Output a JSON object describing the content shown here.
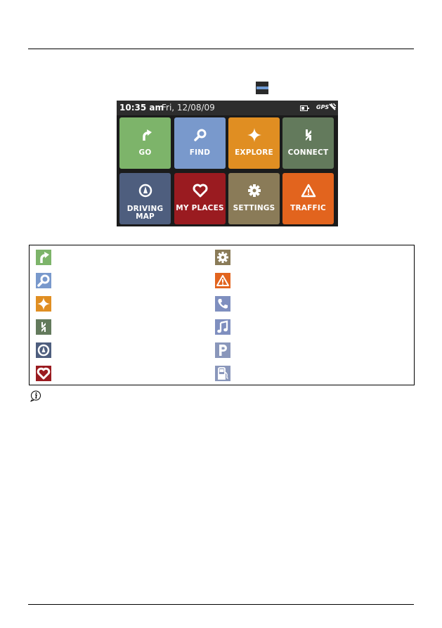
{
  "page": {
    "menu_button_icon": "menu-icon"
  },
  "device": {
    "status_bar": {
      "time": "10:35 am",
      "date": "Fri, 12/08/09",
      "gps_label": "GPS",
      "battery_icon": "battery-icon",
      "signal_icon": "gps-signal-icon"
    },
    "tiles": [
      {
        "label": "GO",
        "icon": "turn-arrow-icon",
        "color": "#7db46a"
      },
      {
        "label": "FIND",
        "icon": "magnifier-icon",
        "color": "#7999cc"
      },
      {
        "label": "EXPLORE",
        "icon": "sparkle-icon",
        "color": "#e08e22"
      },
      {
        "label": "CONNECT",
        "icon": "connect-icon",
        "color": "#637a5c"
      },
      {
        "label_line1": "DRIVING",
        "label_line2": "MAP",
        "icon": "compass-icon",
        "color": "#4e5e7e"
      },
      {
        "label": "MY PLACES",
        "icon": "heart-icon",
        "color": "#9a1b20"
      },
      {
        "label": "SETTINGS",
        "icon": "gear-icon",
        "color": "#8a7b58"
      },
      {
        "label": "TRAFFIC",
        "icon": "warning-icon",
        "color": "#e2641e"
      }
    ]
  },
  "legend": {
    "left_column": [
      {
        "icon": "turn-arrow-icon",
        "color": "#7db46a"
      },
      {
        "icon": "magnifier-icon",
        "color": "#7999cc"
      },
      {
        "icon": "sparkle-icon",
        "color": "#e08e22"
      },
      {
        "icon": "connect-icon",
        "color": "#637a5c"
      },
      {
        "icon": "compass-icon",
        "color": "#4e5e7e"
      },
      {
        "icon": "heart-icon",
        "color": "#9a1b20"
      }
    ],
    "right_column": [
      {
        "icon": "gear-icon",
        "color": "#8a7b58"
      },
      {
        "icon": "warning-icon",
        "color": "#e2641e"
      },
      {
        "icon": "phone-icon",
        "color": "#7f8fbf"
      },
      {
        "icon": "music-note-icon",
        "color": "#7f8fbf"
      },
      {
        "icon": "parking-icon",
        "color": "#8a97bb"
      },
      {
        "icon": "fuel-pump-icon",
        "color": "#8a97bb"
      }
    ]
  },
  "note": {
    "icon": "info-icon"
  }
}
